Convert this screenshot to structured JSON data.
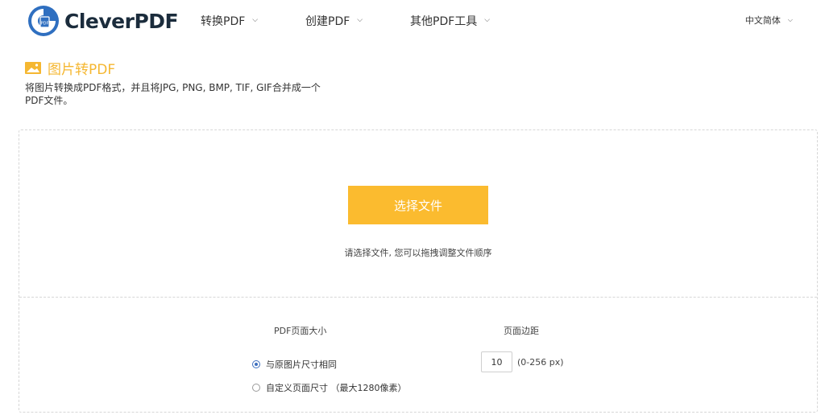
{
  "header": {
    "logo_text": "CleverPDF",
    "nav": [
      {
        "label": "转换PDF"
      },
      {
        "label": "创建PDF"
      },
      {
        "label": "其他PDF工具"
      }
    ],
    "language": "中文简体"
  },
  "page": {
    "title": "图片转PDF",
    "description": "将图片转换成PDF格式，并且将JPG, PNG, BMP, TIF, GIF合并成一个PDF文件。"
  },
  "upload": {
    "choose_button": "选择文件",
    "hint": "请选择文件, 您可以拖拽调整文件顺序"
  },
  "options": {
    "page_size_label": "PDF页面大小",
    "page_size_options": [
      {
        "label": "与原图片尺寸相同",
        "checked": true
      },
      {
        "label": "自定义页面尺寸 （最大1280像素）",
        "checked": false
      }
    ],
    "margin_label": "页面边距",
    "margin_value": "10",
    "margin_range": "(0-256 px)"
  },
  "colors": {
    "accent": "#fbbb2f",
    "title": "#f5b731",
    "logo_blue": "#2f6fc0",
    "radio_blue": "#3e6fbf"
  }
}
